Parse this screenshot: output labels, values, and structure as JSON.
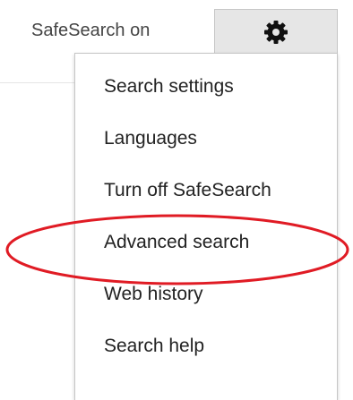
{
  "header": {
    "safesearch_status": "SafeSearch on",
    "settings_icon": "gear-icon"
  },
  "menu": {
    "items": [
      {
        "label": "Search settings"
      },
      {
        "label": "Languages"
      },
      {
        "label": "Turn off SafeSearch"
      },
      {
        "label": "Advanced search"
      },
      {
        "label": "Web history"
      },
      {
        "label": "Search help"
      }
    ]
  },
  "annotation": {
    "highlighted_item": "Advanced search",
    "color": "#e01b24"
  },
  "colors": {
    "button_bg": "#e6e6e6",
    "border": "#c6c6c6",
    "text": "#222222",
    "status_text": "#444444"
  }
}
